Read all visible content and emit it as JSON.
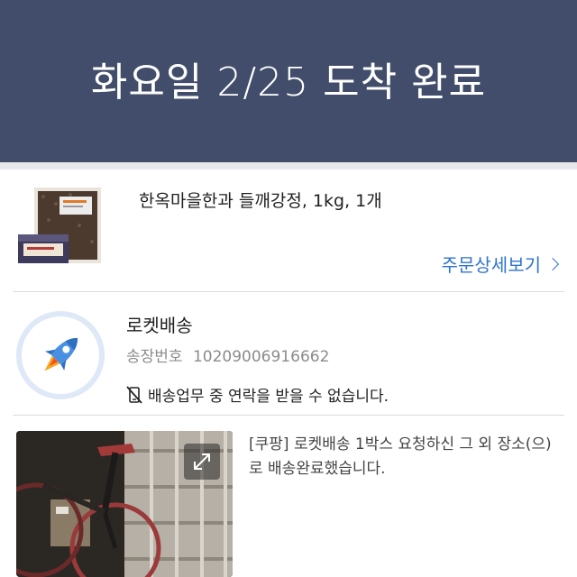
{
  "header": {
    "title": "화요일 2/25 도착 완료",
    "background_color": "#414d6a"
  },
  "product": {
    "name": "한옥마을한과 들깨강정, 1kg, 1개",
    "order_detail_label": "주문상세보기",
    "link_color": "#2f74d0"
  },
  "delivery": {
    "type": "로켓배송",
    "icon": "rocket-icon",
    "tracking_label": "송장번호",
    "tracking_number": "10209006916662",
    "notice_icon": "no-phone-icon",
    "notice": "배송업무 중 연락을 받을 수 없습니다."
  },
  "completion": {
    "photo_icon": "expand-icon",
    "message": "[쿠팡] 로켓배송 1박스 요청하신 그 외 장소(으)로 배송완료했습니다."
  }
}
